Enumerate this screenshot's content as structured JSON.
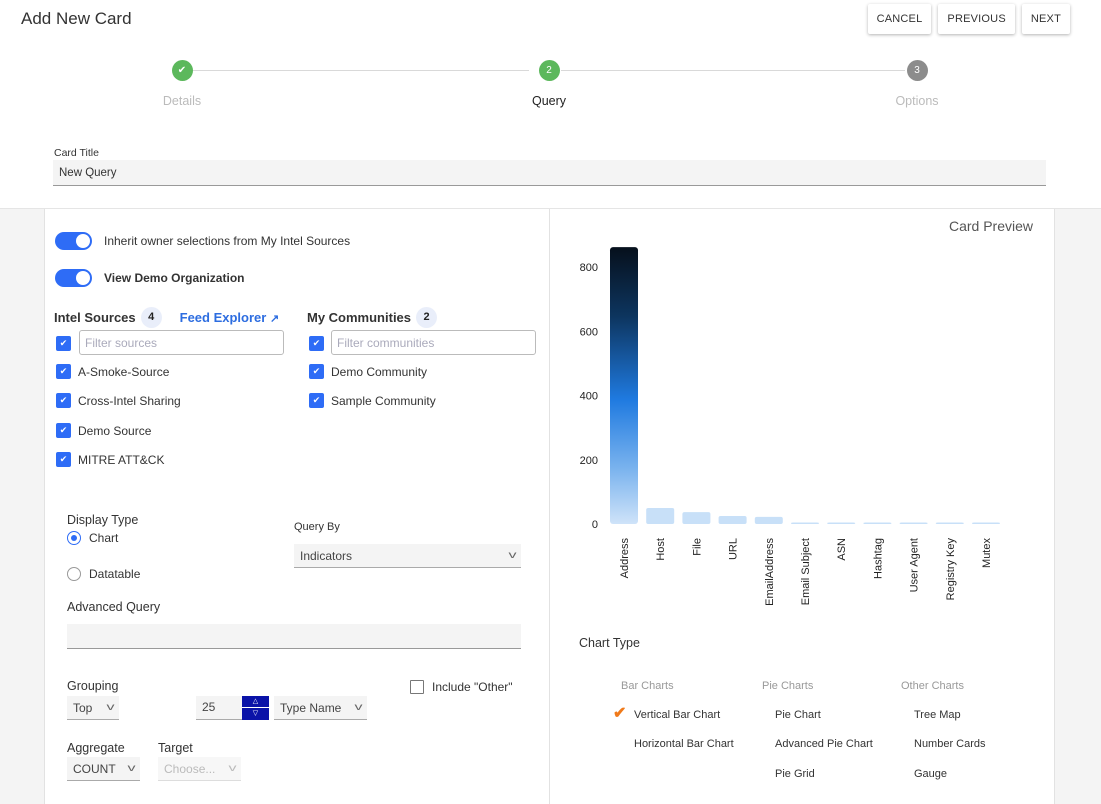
{
  "header": {
    "title": "Add New Card",
    "buttons": {
      "cancel": "CANCEL",
      "previous": "PREVIOUS",
      "next": "NEXT"
    }
  },
  "stepper": {
    "steps": [
      {
        "label": "Details",
        "marker": "✔",
        "state": "complete"
      },
      {
        "label": "Query",
        "marker": "2",
        "state": "active"
      },
      {
        "label": "Options",
        "marker": "3",
        "state": "pending"
      }
    ],
    "colors": {
      "complete": "#5cb85c",
      "active": "#5cb85c",
      "pending": "#8c8c8c"
    }
  },
  "card_title": {
    "label": "Card Title",
    "value": "New Query"
  },
  "query": {
    "toggles": [
      {
        "label": "Inherit owner selections from My Intel Sources",
        "on": true
      },
      {
        "label": "View Demo Organization",
        "on": true
      }
    ],
    "intel_sources": {
      "title": "Intel Sources",
      "count": "4",
      "feed_explorer": "Feed Explorer",
      "feed_explorer_icon": "↗",
      "filter_placeholder": "Filter sources",
      "items": [
        "A-Smoke-Source",
        "Cross-Intel Sharing",
        "Demo Source",
        "MITRE ATT&CK"
      ]
    },
    "communities": {
      "title": "My Communities",
      "count": "2",
      "filter_placeholder": "Filter communities",
      "items": [
        "Demo Community",
        "Sample Community"
      ]
    },
    "display_type": {
      "label": "Display Type",
      "options": [
        {
          "label": "Chart",
          "selected": true
        },
        {
          "label": "Datatable",
          "selected": false
        }
      ]
    },
    "query_by": {
      "label": "Query By",
      "value": "Indicators"
    },
    "advanced_query": {
      "label": "Advanced Query",
      "value": ""
    },
    "grouping": {
      "label": "Grouping",
      "value": "Top",
      "count": "25",
      "field": "Type Name"
    },
    "include_other": {
      "label": "Include \"Other\"",
      "checked": false
    },
    "aggregate": {
      "label": "Aggregate",
      "value": "COUNT"
    },
    "target": {
      "label": "Target",
      "placeholder": "Choose..."
    }
  },
  "preview": {
    "title": "Card Preview",
    "chart_type_label": "Chart Type",
    "chart_type_groups": [
      {
        "title": "Bar Charts",
        "items": [
          "Vertical Bar Chart",
          "Horizontal Bar Chart"
        ]
      },
      {
        "title": "Pie Charts",
        "items": [
          "Pie Chart",
          "Advanced Pie Chart",
          "Pie Grid"
        ]
      },
      {
        "title": "Other Charts",
        "items": [
          "Tree Map",
          "Number Cards",
          "Gauge"
        ]
      }
    ],
    "selected_chart_type": "Vertical Bar Chart"
  },
  "chart_data": {
    "type": "bar",
    "title": "",
    "xlabel": "",
    "ylabel": "",
    "categories": [
      "Address",
      "Host",
      "File",
      "URL",
      "EmailAddress",
      "Email Subject",
      "ASN",
      "Hashtag",
      "User Agent",
      "Registry Key",
      "Mutex"
    ],
    "values": [
      862,
      50,
      37,
      25,
      22,
      1,
      1,
      1,
      1,
      1,
      1
    ],
    "yticks": [
      0,
      200,
      400,
      600,
      800
    ],
    "ylim": [
      0,
      862
    ],
    "grid": false,
    "legend": "none"
  }
}
